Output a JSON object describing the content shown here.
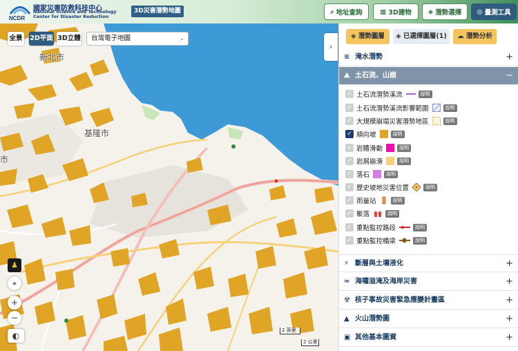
{
  "header": {
    "org_name_zh": "國家災害防救科技中心",
    "org_name_en": "National Science and Technology Center for Disaster Reduction",
    "logo_text": "NCDR",
    "map_name": "3D災害潛勢地圖",
    "buttons": [
      {
        "label": "地址查詢",
        "icon": "search-icon"
      },
      {
        "label": "3D建物",
        "icon": "building-icon"
      },
      {
        "label": "潛勢選擇",
        "icon": "layers-icon"
      },
      {
        "label": "量測工具",
        "icon": "measure-icon"
      }
    ]
  },
  "map": {
    "view_buttons": [
      "全景",
      "2D平面",
      "3D立體"
    ],
    "active_view": "2D平面",
    "basemap_select": "台灣電子地圖",
    "place_labels": [
      "新北市",
      "基隆市",
      "市"
    ],
    "scale_bars": [
      "2 英里",
      "2 公里"
    ],
    "colors": {
      "sea": "#3e9ad6",
      "land": "#f5f2ec",
      "hazard": "#e0a526"
    }
  },
  "panel": {
    "tabs": [
      {
        "label": "潛勢圖層",
        "color": "#f5c45e"
      },
      {
        "label": "已選擇圖層(1)",
        "color": "#e6ecf2"
      },
      {
        "label": "潛勢分析",
        "color": "#f5c45e"
      }
    ],
    "sections_top": [
      {
        "label": "淹水潛勢",
        "icon": "flood-icon",
        "toggle": "+"
      },
      {
        "label": "土石流、山崩",
        "icon": "landslide-icon",
        "toggle": "−"
      }
    ],
    "layers": [
      {
        "label": "土石流潛勢溪流",
        "checked": false,
        "symbol": "purple-line"
      },
      {
        "label": "土石流潛勢溪流影響範圍",
        "checked": false,
        "symbol": "hatch-box"
      },
      {
        "label": "大規模崩塌災害潛勢地區",
        "checked": false,
        "symbol": "dotted-box"
      },
      {
        "label": "順向坡",
        "checked": true,
        "symbol": "orange-box"
      },
      {
        "label": "岩體滑動",
        "checked": false,
        "symbol": "magenta-box"
      },
      {
        "label": "岩屑崩滑",
        "checked": false,
        "symbol": "yellow-box"
      },
      {
        "label": "落石",
        "checked": false,
        "symbol": "violet-box"
      },
      {
        "label": "歷史坡地災害位置",
        "checked": false,
        "symbol": "diamond-icon"
      },
      {
        "label": "雨量站",
        "checked": false,
        "symbol": "rain-gauge-icon"
      },
      {
        "label": "聚落",
        "checked": false,
        "symbol": "settlement-icon"
      },
      {
        "label": "重點監控路段",
        "checked": false,
        "symbol": "road-icon"
      },
      {
        "label": "重點監控橋梁",
        "checked": false,
        "symbol": "bridge-icon"
      }
    ],
    "info_label": "說明",
    "sections_bottom": [
      {
        "label": "斷層與土壤液化",
        "icon": "fault-icon"
      },
      {
        "label": "海嘯溢淹及海岸災害",
        "icon": "wave-icon"
      },
      {
        "label": "核子事故災害緊急應變計畫區",
        "icon": "nuclear-icon"
      },
      {
        "label": "火山潛勢圖",
        "icon": "volcano-icon"
      },
      {
        "label": "其他基本圖資",
        "icon": "map-icon"
      }
    ],
    "plus": "+"
  }
}
